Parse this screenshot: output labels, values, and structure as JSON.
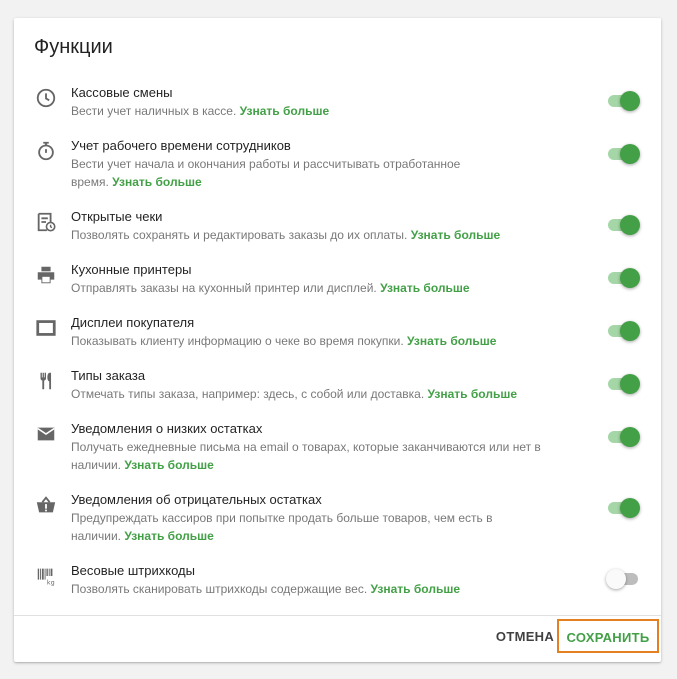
{
  "dialog": {
    "title": "Функции",
    "cancel_label": "ОТМЕНА",
    "save_label": "СОХРАНИТЬ"
  },
  "features": [
    {
      "name": "Кассовые смены",
      "desc": "Вести учет наличных в кассе.",
      "more": "Узнать больше",
      "enabled": true,
      "icon": "clock-icon"
    },
    {
      "name": "Учет рабочего времени сотрудников",
      "desc": "Вести учет начала и окончания работы и рассчитывать отработанное время.",
      "more": "Узнать больше",
      "enabled": true,
      "icon": "stopwatch-icon"
    },
    {
      "name": "Открытые чеки",
      "desc": "Позволять сохранять и редактировать заказы до их оплаты.",
      "more": "Узнать больше",
      "enabled": true,
      "icon": "receipt-clock-icon"
    },
    {
      "name": "Кухонные принтеры",
      "desc": "Отправлять заказы на кухонный принтер или дисплей.",
      "more": "Узнать больше",
      "enabled": true,
      "icon": "printer-icon"
    },
    {
      "name": "Дисплеи покупателя",
      "desc": "Показывать клиенту информацию о чеке во время покупки.",
      "more": "Узнать больше",
      "enabled": true,
      "icon": "display-icon"
    },
    {
      "name": "Типы заказа",
      "desc": "Отмечать типы заказа, например: здесь, с собой или доставка.",
      "more": "Узнать больше",
      "enabled": true,
      "icon": "cutlery-icon"
    },
    {
      "name": "Уведомления о низких остатках",
      "desc": "Получать ежедневные письма на email о товарах, которые заканчиваются или нет в наличии.",
      "more": "Узнать больше",
      "enabled": true,
      "icon": "envelope-icon"
    },
    {
      "name": "Уведомления об отрицательных остатках",
      "desc": "Предупреждать кассиров при попытке продать больше товаров, чем есть в наличии.",
      "more": "Узнать больше",
      "enabled": true,
      "icon": "basket-alert-icon"
    },
    {
      "name": "Весовые штрихкоды",
      "desc": "Позволять сканировать штрихкоды содержащие вес.",
      "more": "Узнать больше",
      "enabled": false,
      "icon": "barcode-kg-icon"
    }
  ],
  "colors": {
    "accent": "#43a047",
    "highlight_border": "#e67e22"
  }
}
